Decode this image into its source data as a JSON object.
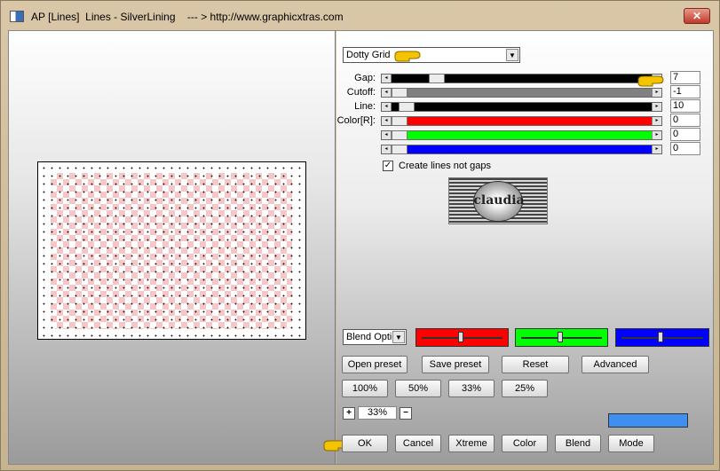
{
  "window": {
    "title": "AP [Lines]  Lines - SilverLining    --- > http://www.graphicxtras.com",
    "close_label": "✕"
  },
  "preset_combo": {
    "value": "Dotty Grid"
  },
  "params": [
    {
      "label": "Gap:",
      "value": "7",
      "track_color": "#000000",
      "fill": 0.15
    },
    {
      "label": "Cutoff:",
      "value": "-1",
      "track_color": "#808080",
      "fill": 0.0
    },
    {
      "label": "Line:",
      "value": "10",
      "track_color": "#000000",
      "fill": 0.03
    },
    {
      "label": "Color[R]:",
      "value": "0",
      "track_color": "#ff0000",
      "fill": 0.0
    },
    {
      "label": "",
      "value": "0",
      "track_color": "#00ff00",
      "fill": 0.0
    },
    {
      "label": "",
      "value": "0",
      "track_color": "#0000ff",
      "fill": 0.0
    }
  ],
  "create_lines": {
    "label": "Create lines not gaps",
    "checked": true,
    "check_glyph": "✓"
  },
  "logo": {
    "text": "claudia"
  },
  "blend_combo": {
    "value": "Blend Optic"
  },
  "blend_sliders": [
    {
      "color": "#ff0000",
      "level": 0.5
    },
    {
      "color": "#00ff00",
      "level": 0.5
    },
    {
      "color": "#0000ff",
      "level": 0.5
    }
  ],
  "buttons": {
    "open_preset": "Open preset",
    "save_preset": "Save preset",
    "reset": "Reset",
    "advanced": "Advanced",
    "zoom_100": "100%",
    "zoom_50": "50%",
    "zoom_33": "33%",
    "zoom_25": "25%",
    "ok": "OK",
    "cancel": "Cancel",
    "xtreme": "Xtreme",
    "color": "Color",
    "blend": "Blend",
    "mode": "Mode"
  },
  "zoom": {
    "plus": "+",
    "value": "33%",
    "minus": "−"
  },
  "swatch_color": "#3d8ff0",
  "accent_pointer_color": "#f5c400"
}
